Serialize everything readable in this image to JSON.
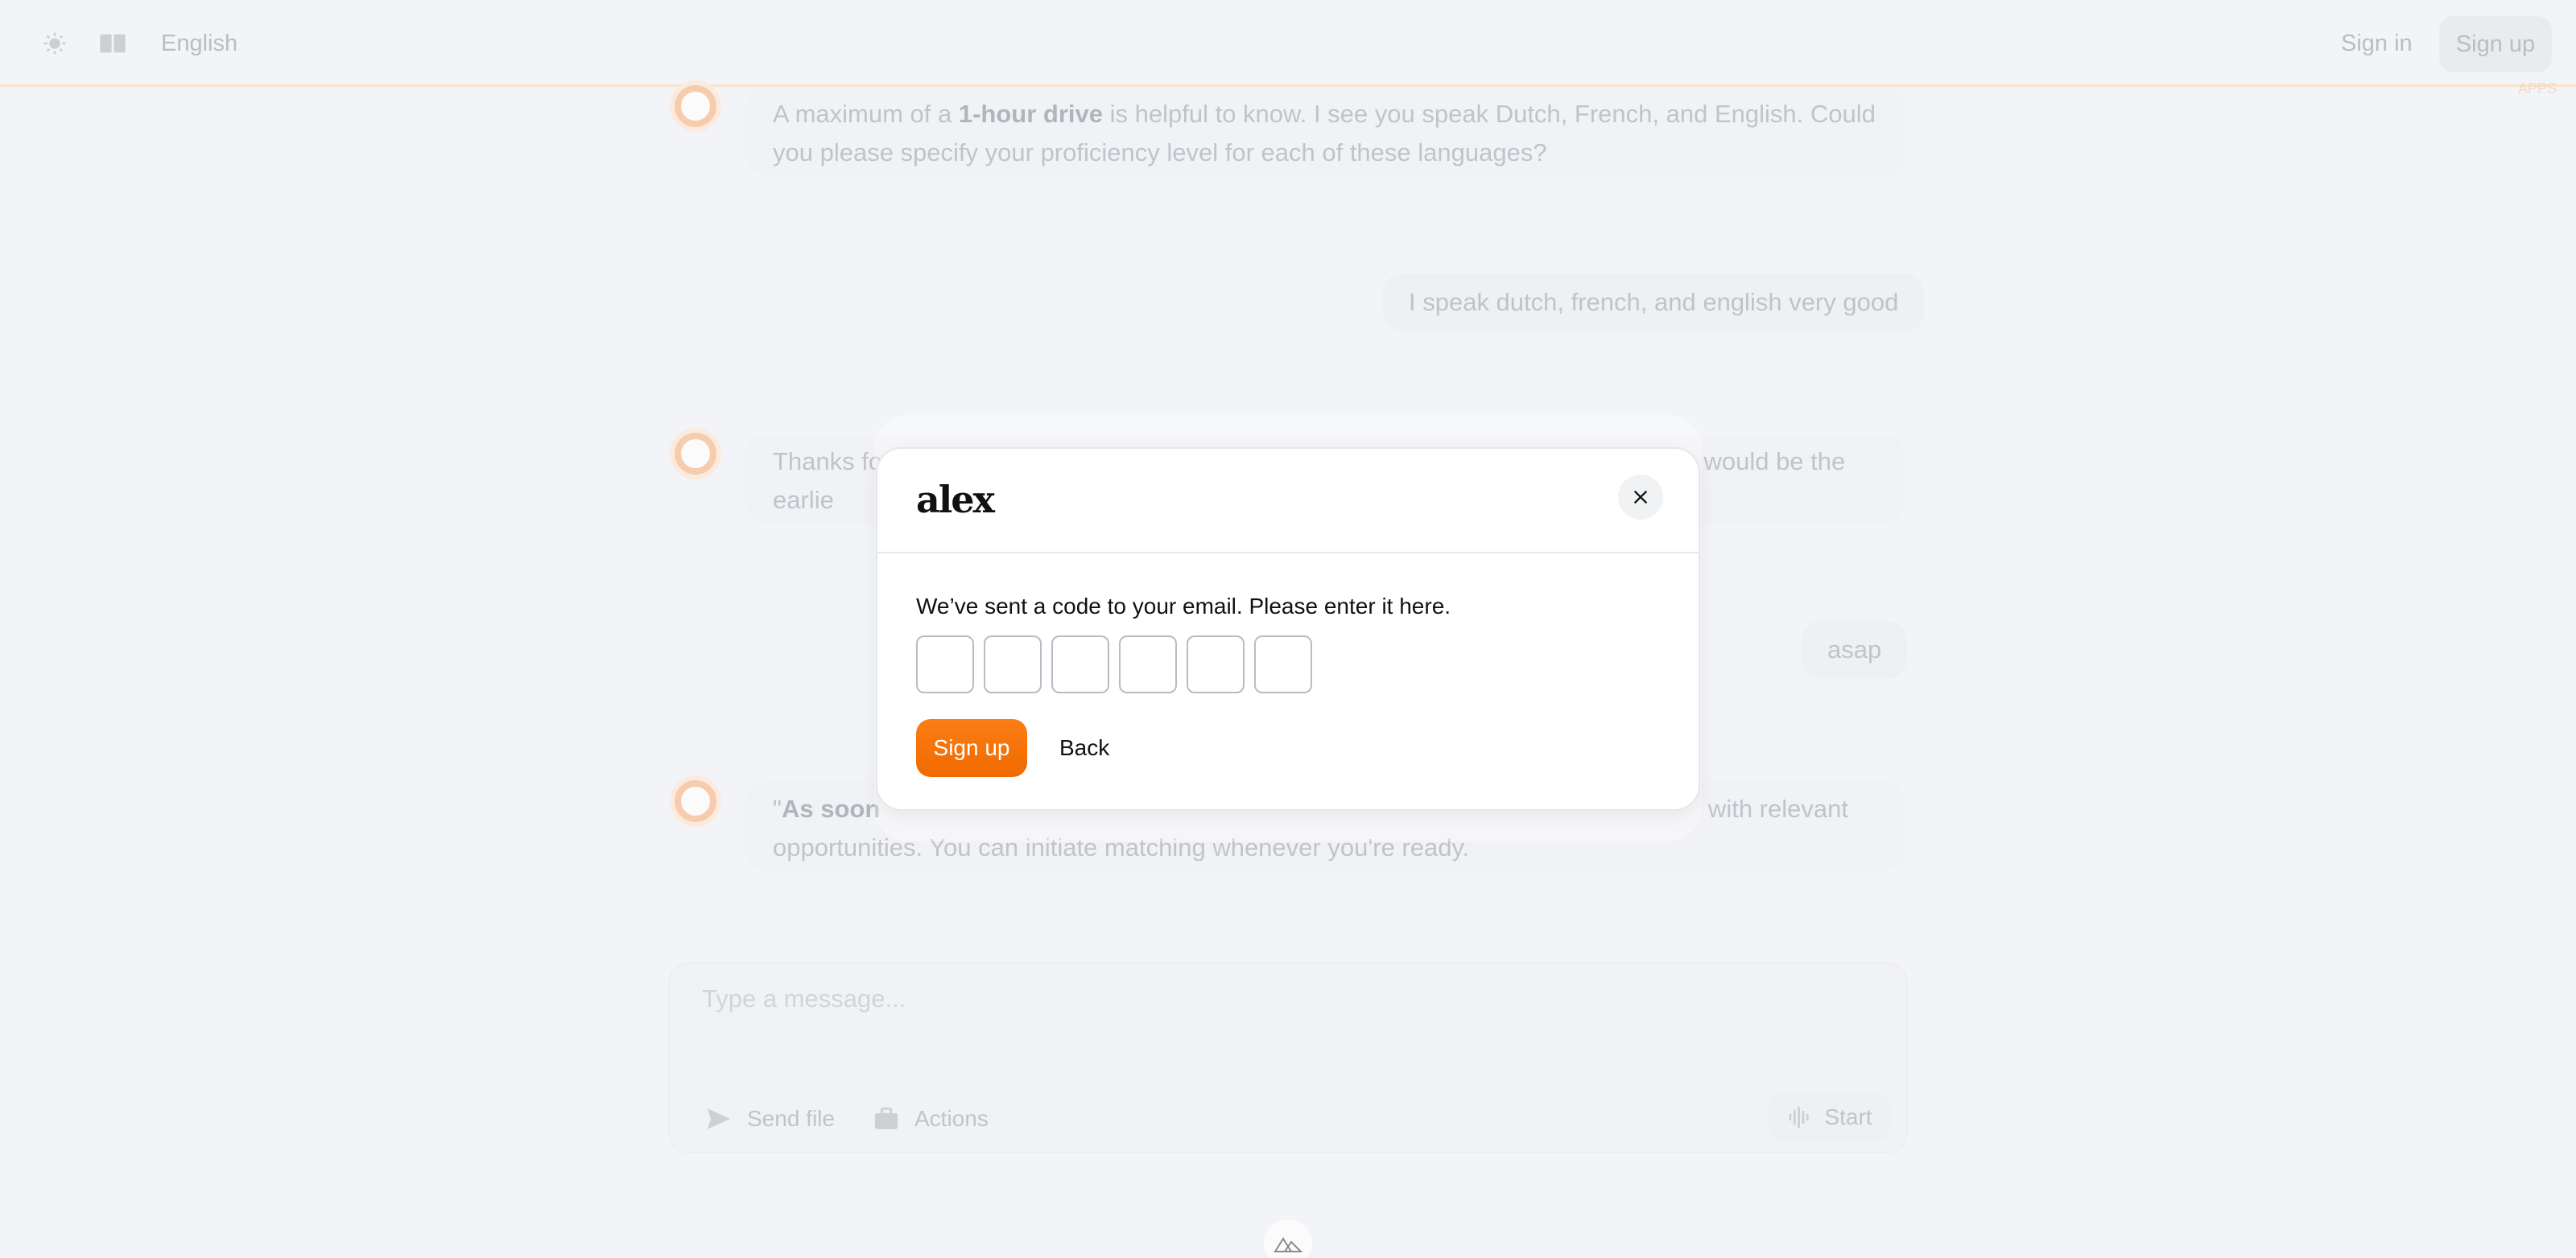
{
  "header": {
    "language": "English",
    "sign_in": "Sign in",
    "sign_up": "Sign up",
    "badge": "APPS"
  },
  "chat": {
    "messages": [
      {
        "role": "bot",
        "parts": [
          "A maximum of a ",
          "1-hour drive",
          " is helpful to know. I see you speak Dutch, French, and English. Could you please specify your proficiency level for each of these languages?"
        ]
      },
      {
        "role": "user",
        "text": "I speak dutch, french, and english very good"
      },
      {
        "role": "bot",
        "parts": [
          "Thanks fo",
          "",
          "hen would be the earlie"
        ]
      },
      {
        "role": "user",
        "text": "asap"
      },
      {
        "role": "bot",
        "parts": [
          "\"",
          "As soon",
          " with relevant opportunities. You can initiate matching whenever you're ready."
        ]
      }
    ]
  },
  "composer": {
    "placeholder": "Type a message...",
    "send_file": "Send file",
    "actions": "Actions",
    "start": "Start"
  },
  "modal": {
    "logo": "alex",
    "message": "We’ve sent a code to your email. Please enter it here.",
    "code_length": 6,
    "primary_label": "Sign up",
    "secondary_label": "Back"
  },
  "colors": {
    "accent": "#f47b0c",
    "header_border": "#fcd9b3",
    "background": "#f3f4f7"
  }
}
